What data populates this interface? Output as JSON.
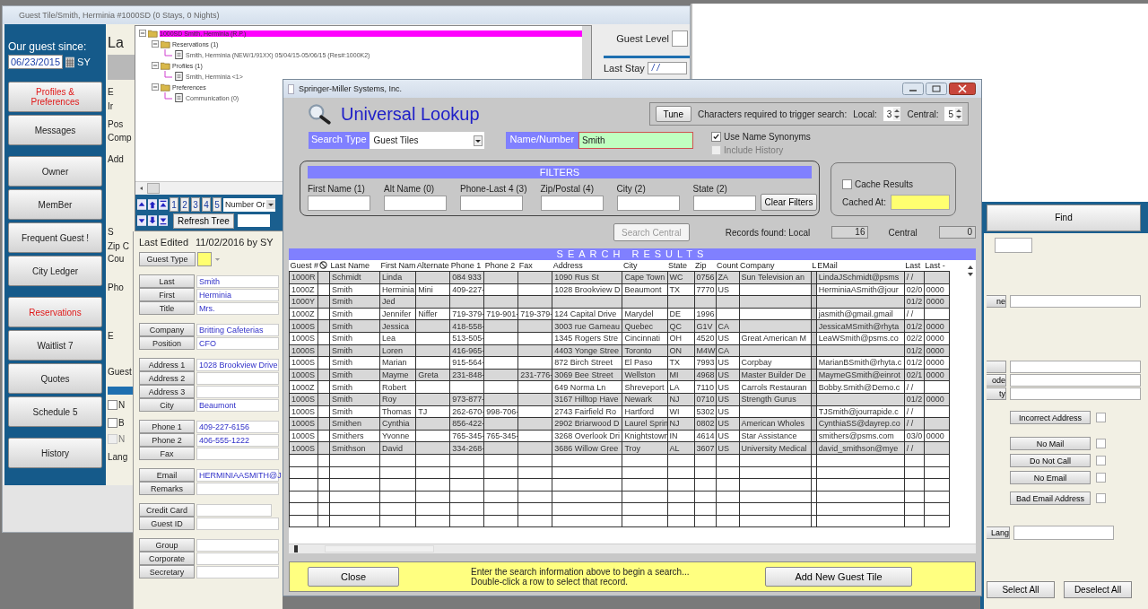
{
  "guest_window": {
    "title": "Guest Tile/Smith, Herminia #1000SD   (0 Stays, 0 Nights)",
    "sidebar": {
      "since_label": "Our guest since:",
      "since_date": "06/23/2015",
      "user": "SY",
      "groups": [
        [
          {
            "label": "Profiles & Preferences",
            "highlighted": true
          },
          {
            "label": "Messages",
            "highlighted": false
          }
        ],
        [
          {
            "label": "Owner",
            "highlighted": false
          },
          {
            "label": "MemBer",
            "highlighted": false
          },
          {
            "label": "Frequent Guest !",
            "highlighted": false
          },
          {
            "label": "City Ledger",
            "highlighted": false
          }
        ],
        [
          {
            "label": "Reservations",
            "highlighted": true
          },
          {
            "label": "Waitlist 7",
            "highlighted": false
          },
          {
            "label": "Quotes",
            "highlighted": false
          },
          {
            "label": "Schedule 5",
            "highlighted": false
          }
        ],
        [
          {
            "label": "History",
            "highlighted": false
          }
        ]
      ]
    },
    "form_fragments": [
      {
        "kind": "heading",
        "text": "La"
      },
      {
        "kind": "panel"
      },
      {
        "kind": "label",
        "text": "E"
      },
      {
        "kind": "label",
        "text": "Ir"
      },
      {
        "kind": "label",
        "text": "Pos"
      },
      {
        "kind": "label",
        "text": "Comp"
      },
      {
        "kind": "label",
        "text": "Add"
      },
      {
        "kind": "label",
        "text": "S"
      },
      {
        "kind": "label",
        "text": "Zip C"
      },
      {
        "kind": "label",
        "text": "Cou"
      },
      {
        "kind": "label",
        "text": "Pho"
      },
      {
        "kind": "label",
        "text": "E"
      },
      {
        "kind": "label",
        "text": "Guest"
      },
      {
        "kind": "stripe"
      },
      {
        "kind": "checkbox",
        "text": "N",
        "checked": false,
        "disabled": false
      },
      {
        "kind": "checkbox",
        "text": "B",
        "checked": false,
        "disabled": false
      },
      {
        "kind": "checkbox",
        "text": "N",
        "checked": false,
        "disabled": true
      },
      {
        "kind": "label",
        "text": "Lang"
      }
    ],
    "guest_level": {
      "label": "Guest Level"
    },
    "last_stay": {
      "label": "Last Stay",
      "value": "/ /"
    }
  },
  "tree": {
    "nodes": [
      {
        "label": "1000SD Smith, Herminia (R.P.)",
        "kind": "folder",
        "expanded": true,
        "selected": true,
        "children": [
          {
            "label": "Reservations (1)",
            "kind": "folder",
            "expanded": true,
            "selected": false,
            "children": [
              {
                "label": "Smith, Herminia (NEW/1/91XX) 05/04/15-05/06/15 (Res#:1000K2)",
                "kind": "document",
                "selected": false
              }
            ]
          },
          {
            "label": "Profiles (1)",
            "kind": "folder",
            "expanded": true,
            "selected": false,
            "children": [
              {
                "label": "Smith, Herminia <1>",
                "kind": "document",
                "selected": false
              }
            ]
          },
          {
            "label": "Preferences",
            "kind": "folder",
            "expanded": true,
            "selected": false,
            "children": [
              {
                "label": "Communication (0)",
                "kind": "document",
                "selected": false
              }
            ]
          }
        ]
      }
    ],
    "page_buttons": [
      "1",
      "2",
      "3",
      "4",
      "5"
    ],
    "sort": {
      "value": "Number Or"
    },
    "refresh": "Refresh Tree"
  },
  "guest_form": {
    "last_edited_label": "Last Edited",
    "last_edited_value": "11/02/2016 by  SY",
    "guest_type": "Guest Type",
    "groups": [
      [
        {
          "label": "Last",
          "value": "Smith"
        },
        {
          "label": "First",
          "value": "Herminia"
        },
        {
          "label": "Title",
          "value": "Mrs."
        }
      ],
      [
        {
          "label": "Company",
          "value": "Britting Cafeterias"
        },
        {
          "label": "Position",
          "value": "CFO"
        }
      ],
      [
        {
          "label": "Address 1",
          "value": "1028 Brookview Drive"
        },
        {
          "label": "Address 2"
        },
        {
          "label": "Address 3"
        },
        {
          "label": "City",
          "value": "Beaumont"
        }
      ],
      [
        {
          "label": "Phone 1",
          "value": "409-227-6156"
        },
        {
          "label": "Phone 2",
          "value": "406-555-1222"
        },
        {
          "label": "Fax"
        }
      ],
      [
        {
          "label": "Email",
          "value": "HERMINIAASMITH@J"
        },
        {
          "label": "Remarks"
        }
      ],
      [
        {
          "label": "Credit Card",
          "kind": "short"
        },
        {
          "label": "Guest ID"
        }
      ],
      [
        {
          "label": "Group"
        },
        {
          "label": "Corporate"
        },
        {
          "label": "Secretary"
        }
      ]
    ]
  },
  "right_panel": {
    "find": "Find",
    "fragments": [
      "ne",
      "ode",
      "ty"
    ],
    "flags": [
      {
        "label": "Incorrect Address",
        "checked": false
      },
      {
        "label": "No Mail",
        "checked": false
      },
      {
        "label": "Do Not Call",
        "checked": false
      },
      {
        "label": "No Email",
        "checked": false
      },
      {
        "label": "Bad Email Address",
        "checked": false
      }
    ],
    "lang": "Lang",
    "select_all": "Select All",
    "deselect_all": "Deselect All"
  },
  "dialog": {
    "title": "Springer-Miller Systems, Inc.",
    "heading": "Universal Lookup",
    "tune": "Tune",
    "trigger_label": "Characters required to trigger search:",
    "local_label": "Local:",
    "local_value": "3",
    "central_label": "Central:",
    "central_value": "5",
    "search_type": {
      "label": "Search Type",
      "value": "Guest Tiles"
    },
    "name_number": {
      "label": "Name/Number",
      "value": "Smith"
    },
    "options": [
      {
        "label": "Use Name Synonyms",
        "checked": true,
        "disabled": false
      },
      {
        "label": "Include History",
        "checked": false,
        "disabled": true
      }
    ],
    "filters": {
      "title": "FILTERS",
      "fields": [
        "First Name (1)",
        "Alt Name (0)",
        "Phone-Last 4 (3)",
        "Zip/Postal (4)",
        "City (2)",
        "State (2)"
      ],
      "clear": "Clear Filters"
    },
    "cache": {
      "label": "Cache Results",
      "checked": false,
      "cached_at": "Cached At:"
    },
    "search_central": {
      "label": "Search Central",
      "disabled": true
    },
    "records_local_label": "Records found: Local",
    "records_local": "16",
    "records_central_label": "Central",
    "records_central": "0",
    "results": {
      "title": "SEARCH RESULTS",
      "columns": [
        {
          "label": "Guest #",
          "kind": "data"
        },
        {
          "kind": "icon"
        },
        {
          "label": "Last Name",
          "kind": "data"
        },
        {
          "label": "First Nam",
          "kind": "data"
        },
        {
          "label": "Alternate",
          "kind": "data"
        },
        {
          "label": "Phone 1",
          "kind": "data"
        },
        {
          "label": "Phone 2",
          "kind": "data"
        },
        {
          "label": "Fax",
          "kind": "data"
        },
        {
          "label": "Address",
          "kind": "data"
        },
        {
          "label": "City",
          "kind": "data"
        },
        {
          "label": "State",
          "kind": "data"
        },
        {
          "label": "Zip",
          "kind": "data"
        },
        {
          "label": "Count",
          "kind": "data"
        },
        {
          "label": "Company",
          "kind": "data"
        },
        {
          "label": "L",
          "kind": "blank"
        },
        {
          "label": "EMail",
          "kind": "data"
        },
        {
          "label": "Last",
          "kind": "data"
        },
        {
          "label": "Last -",
          "kind": "data"
        }
      ],
      "rows": [
        [
          "1000R",
          null,
          "Schmidt",
          "Linda",
          null,
          "084 933",
          null,
          null,
          "1090 Rus St",
          "Cape Town",
          "WC",
          "0756",
          "ZA",
          "Sun Television an",
          null,
          "LindaJSchmidt@psms",
          "/ /",
          null
        ],
        [
          "1000Z",
          null,
          "Smith",
          "Herminia",
          "Mini",
          "409-227-",
          null,
          null,
          "1028 Brookview D",
          "Beaumont",
          "TX",
          "7770",
          "US",
          null,
          null,
          "HerminiaASmith@jour",
          "02/0",
          "0000"
        ],
        [
          "1000Y",
          null,
          "Smith",
          "Jed",
          null,
          null,
          null,
          null,
          null,
          null,
          null,
          null,
          null,
          null,
          null,
          null,
          "01/2",
          "0000"
        ],
        [
          "1000Z",
          null,
          "Smith",
          "Jennifer",
          "Niffer",
          "719-379-",
          "719-901-",
          "719-379-",
          "124 Capital Drive",
          "Marydel",
          "DE",
          "1996",
          null,
          null,
          null,
          "jasmith@gmail.gmail",
          "/ /",
          null
        ],
        [
          "1000S",
          null,
          "Smith",
          "Jessica",
          null,
          "418-558-",
          null,
          null,
          "3003 rue Gameau",
          "Quebec",
          "QC",
          "G1V",
          "CA",
          null,
          null,
          "JessicaMSmith@rhyta",
          "01/2",
          "0000"
        ],
        [
          "1000S",
          null,
          "Smith",
          "Lea",
          null,
          "513-505-",
          null,
          null,
          "1345 Rogers Stre",
          "Cincinnati",
          "OH",
          "4520",
          "US",
          "Great American M",
          null,
          "LeaWSmith@psms.co",
          "02/2",
          "0000"
        ],
        [
          "1000S",
          null,
          "Smith",
          "Loren",
          null,
          "416-965-",
          null,
          null,
          "4403 Yonge Stree",
          "Toronto",
          "ON",
          "M4W",
          "CA",
          null,
          null,
          null,
          "01/2",
          "0000"
        ],
        [
          "1000S",
          null,
          "Smith",
          "Marian",
          null,
          "915-564-",
          null,
          null,
          "872 Birch  Street",
          "El Paso",
          "TX",
          "7993",
          "US",
          "Corpbay",
          null,
          "MarianBSmith@rhyta.c",
          "01/2",
          "0000"
        ],
        [
          "1000S",
          null,
          "Smith",
          "Mayme",
          "Greta",
          "231-848-",
          null,
          "231-776-",
          "3069 Bee Street",
          "Wellston",
          "MI",
          "4968",
          "US",
          "Master Builder De",
          null,
          "MaymeGSmith@einrot",
          "02/1",
          "0000"
        ],
        [
          "1000Z",
          null,
          "Smith",
          "Robert",
          null,
          null,
          null,
          null,
          "649 Norma Ln",
          "Shreveport",
          "LA",
          "7110",
          "US",
          "Carrols Restauran",
          null,
          "Bobby.Smith@Demo.c",
          "/ /",
          null
        ],
        [
          "1000S",
          null,
          "Smith",
          "Roy",
          null,
          "973-877-",
          null,
          null,
          "3167 Hilltop Have",
          "Newark",
          "NJ",
          "0710",
          "US",
          "Strength Gurus",
          null,
          null,
          "01/2",
          "0000"
        ],
        [
          "1000S",
          null,
          "Smith",
          "Thomas",
          "TJ",
          "262-670-",
          "998-706-",
          null,
          "2743 Fairfield Ro",
          "Hartford",
          "WI",
          "5302",
          "US",
          null,
          null,
          "TJSmith@jourrapide.c",
          "/ /",
          null
        ],
        [
          "1000S",
          null,
          "Smithen",
          "Cynthia",
          null,
          "856-422-",
          null,
          null,
          "2902 Briarwood D",
          "Laurel Sprin",
          "NJ",
          "0802",
          "US",
          "American Wholes",
          null,
          "CynthiaSS@dayrep.co",
          "/ /",
          null
        ],
        [
          "1000S",
          null,
          "Smithers",
          "Yvonne",
          null,
          "765-345-",
          "765-345-",
          null,
          "3268 Overlook Dri",
          "Knightstown",
          "IN",
          "4614",
          "US",
          "Star Assistance",
          null,
          "smithers@psms.com",
          "03/0",
          "0000"
        ],
        [
          "1000S",
          null,
          "Smithson",
          "David",
          null,
          "334-268-",
          null,
          null,
          "3686 Willow Gree",
          "Troy",
          "AL",
          "3607",
          "US",
          "University Medical",
          null,
          "david_smithson@mye",
          "/ /",
          null
        ]
      ]
    },
    "close": "Close",
    "message": [
      "Enter the search information above to begin a search...",
      "Double-click a row to select that record."
    ],
    "add_new": "Add New Guest Tile"
  }
}
